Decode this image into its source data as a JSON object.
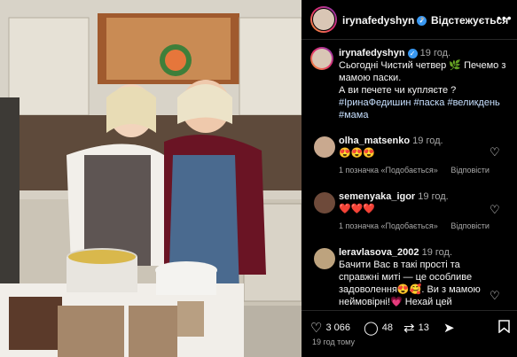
{
  "header": {
    "username": "irynafedyshyn",
    "follow_label": "Відстежується",
    "separator": "•"
  },
  "post": {
    "username": "irynafedyshyn",
    "time": "19 год.",
    "line1": "Сьогодні Чистий четвер 🌿 Печемо з мамою паски.",
    "line2": "А ви печете чи купляєте ?",
    "hashtags": "#ІринаФедишин #паска #великдень #мама"
  },
  "comments": [
    {
      "username": "olha_matsenko",
      "time": "19 год.",
      "text": "😍😍😍",
      "likes": "1 позначка «Подобається»",
      "reply": "Відповісти"
    },
    {
      "username": "semenyaka_igor",
      "time": "19 год.",
      "text": "❤️❤️❤️",
      "likes": "1 позначка «Подобається»",
      "reply": "Відповісти"
    },
    {
      "username": "leravlasova_2002",
      "time": "19 год.",
      "text": "Бачити Вас в такі прості та справжні миті — це особливе задоволення😍🥰. Ви з мамою неймовірні!💗 Нехай цей"
    }
  ],
  "actions": {
    "likes": "3 066",
    "comments": "48",
    "reposts": "13"
  },
  "posted_ago": "19 год тому",
  "icons": {
    "like": "heart-outline",
    "comment": "speech-bubble",
    "repost": "repost-arrows",
    "share": "paper-plane",
    "save": "bookmark",
    "more": "three-dots"
  },
  "colors": {
    "background": "#000000",
    "secondary_text": "#a8a8a8",
    "verified": "#3897f0",
    "hashtag": "#c7e0ff"
  }
}
